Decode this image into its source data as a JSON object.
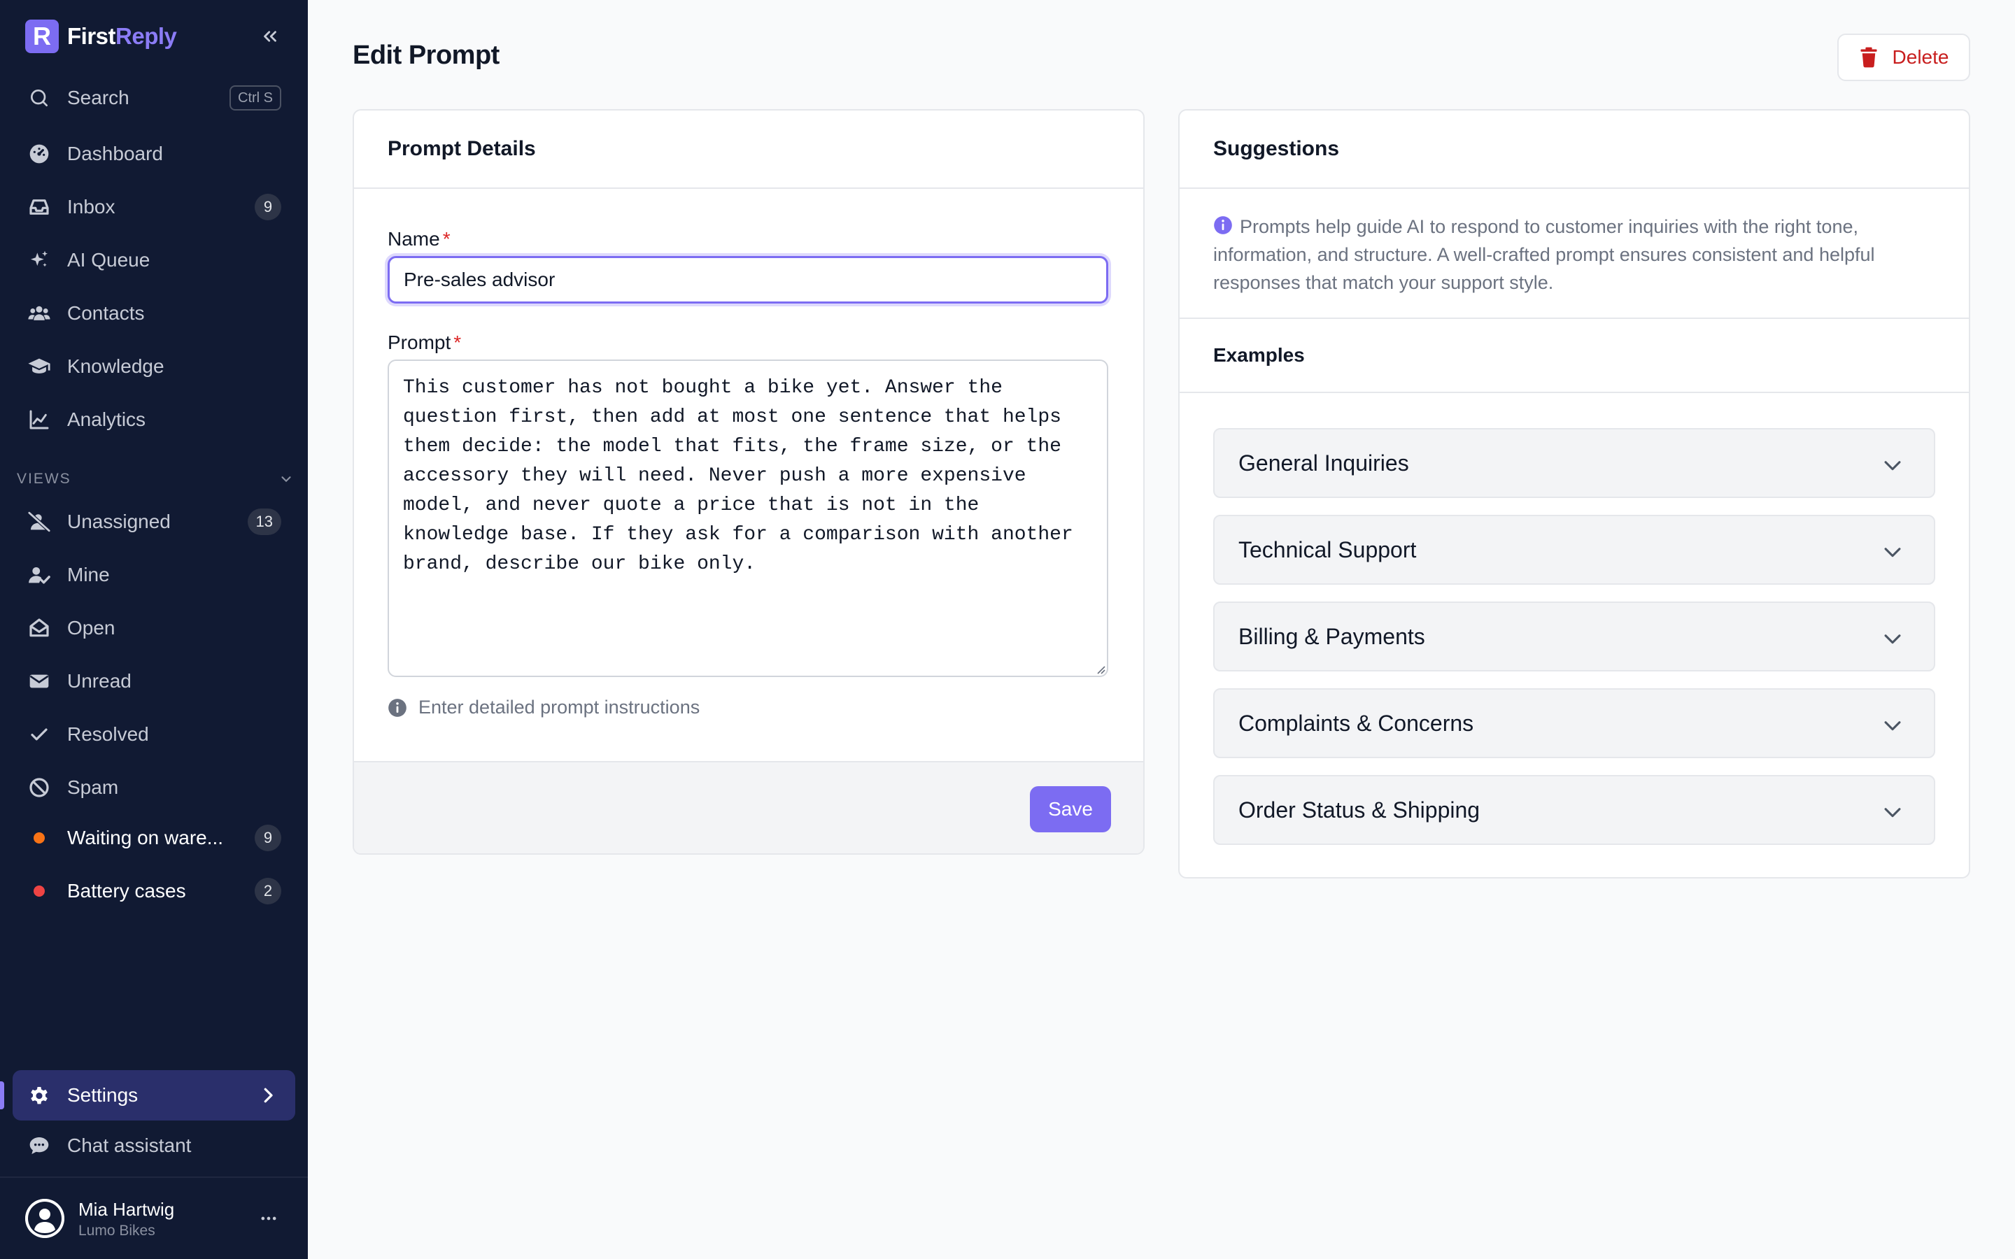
{
  "app": {
    "brand_prefix": "First",
    "brand_suffix": "Reply",
    "logo_letter": "R"
  },
  "sidebar": {
    "search": {
      "label": "Search",
      "shortcut": "Ctrl S"
    },
    "nav": [
      {
        "label": "Dashboard",
        "icon": "dashboard-icon"
      },
      {
        "label": "Inbox",
        "icon": "inbox-icon",
        "badge": "9"
      },
      {
        "label": "AI Queue",
        "icon": "sparkles-icon"
      },
      {
        "label": "Contacts",
        "icon": "contacts-icon"
      },
      {
        "label": "Knowledge",
        "icon": "graduation-cap-icon"
      },
      {
        "label": "Analytics",
        "icon": "chart-line-icon"
      }
    ],
    "views_label": "VIEWS",
    "views": [
      {
        "label": "Unassigned",
        "icon": "user-slash-icon",
        "badge": "13"
      },
      {
        "label": "Mine",
        "icon": "user-check-icon"
      },
      {
        "label": "Open",
        "icon": "envelope-open-icon"
      },
      {
        "label": "Unread",
        "icon": "envelope-icon"
      },
      {
        "label": "Resolved",
        "icon": "check-icon"
      },
      {
        "label": "Spam",
        "icon": "ban-icon"
      },
      {
        "label": "Waiting on ware...",
        "dot_color": "#f97316",
        "badge": "9"
      },
      {
        "label": "Battery cases",
        "dot_color": "#ef4444",
        "badge": "2"
      }
    ],
    "settings": {
      "label": "Settings"
    },
    "chat_assistant": {
      "label": "Chat assistant"
    },
    "user": {
      "name": "Mia Hartwig",
      "org": "Lumo Bikes"
    }
  },
  "page": {
    "title": "Edit Prompt",
    "delete_label": "Delete"
  },
  "prompt_details": {
    "header": "Prompt Details",
    "name_label": "Name",
    "name_value": "Pre-sales advisor",
    "prompt_label": "Prompt",
    "required_mark": "*",
    "prompt_value": "This customer has not bought a bike yet. Answer the question first, then add at most one sentence that helps them decide: the model that fits, the frame size, or the accessory they will need. Never push a more expensive model, and never quote a price that is not in the knowledge base. If they ask for a comparison with another brand, describe our bike only.",
    "hint": "Enter detailed prompt instructions",
    "save_label": "Save"
  },
  "suggestions": {
    "header": "Suggestions",
    "description": "Prompts help guide AI to respond to customer inquiries with the right tone, information, and structure. A well-crafted prompt ensures consistent and helpful responses that match your support style.",
    "examples_header": "Examples",
    "examples": [
      "General Inquiries",
      "Technical Support",
      "Billing & Payments",
      "Complaints & Concerns",
      "Order Status & Shipping"
    ]
  },
  "colors": {
    "sidebar_bg": "#111a33",
    "accent": "#7c6cf2",
    "danger": "#c81e1e"
  }
}
